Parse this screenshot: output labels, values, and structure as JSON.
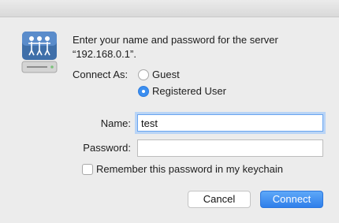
{
  "dialog": {
    "prompt_line1": "Enter your name and password for the server",
    "prompt_line2": "“192.168.0.1”.",
    "connect_as_label": "Connect As:",
    "radio_guest_label": "Guest",
    "radio_registered_label": "Registered User",
    "selected_connect_as": "Registered User",
    "name_label": "Name:",
    "name_value": "test",
    "password_label": "Password:",
    "password_value": "",
    "remember_label": "Remember this password in my keychain",
    "remember_checked": false,
    "cancel_label": "Cancel",
    "connect_label": "Connect"
  },
  "colors": {
    "accent": "#3b8ef0",
    "window_bg": "#ececec"
  },
  "icons": {
    "server": "network-server-icon"
  }
}
